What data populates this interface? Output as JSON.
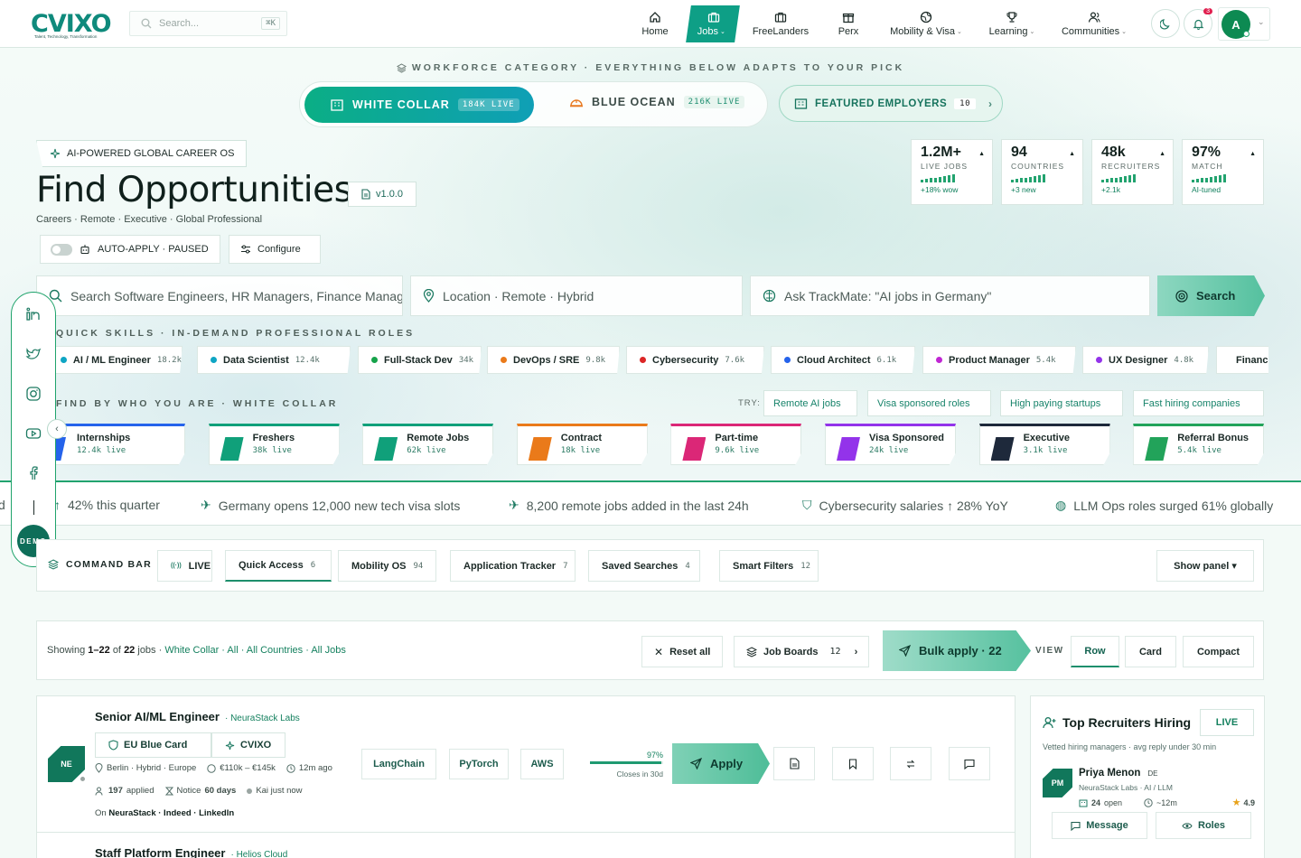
{
  "brand": {
    "name": "CVIXO",
    "tagline": "Talent, Technology, Transformation"
  },
  "top_search": {
    "placeholder": "Search...",
    "shortcut": "⌘K"
  },
  "nav": [
    {
      "label": "Home",
      "icon": "home-icon"
    },
    {
      "label": "Jobs",
      "icon": "briefcase-icon",
      "active": true,
      "dropdown": true
    },
    {
      "label": "FreeLanders",
      "icon": "briefcase-icon"
    },
    {
      "label": "Perx",
      "icon": "gift-icon"
    },
    {
      "label": "Mobility & Visa",
      "icon": "globe-icon",
      "dropdown": true
    },
    {
      "label": "Learning",
      "icon": "trophy-icon",
      "dropdown": true
    },
    {
      "label": "Communities",
      "icon": "users-icon",
      "dropdown": true
    }
  ],
  "user": {
    "avatar_letter": "A",
    "notifications": "3"
  },
  "workforce": {
    "label": "WORKFORCE CATEGORY · EVERYTHING BELOW ADAPTS TO YOUR PICK",
    "white": {
      "label": "WHITE COLLAR",
      "count": "184K LIVE"
    },
    "blue": {
      "label": "BLUE OCEAN",
      "count": "216K LIVE"
    },
    "featured": {
      "label": "FEATURED EMPLOYERS",
      "count": "10"
    }
  },
  "hero": {
    "badge": "AI-POWERED GLOBAL CAREER OS",
    "title": "Find Opportunities",
    "version": "v1.0.0",
    "subtitle": "Careers · Remote · Executive · Global Professional",
    "autoapply": "AUTO-APPLY · PAUSED",
    "configure": "Configure"
  },
  "stats": [
    {
      "value": "1.2M+",
      "label": "LIVE JOBS",
      "delta": "+18% wow"
    },
    {
      "value": "94",
      "label": "COUNTRIES",
      "delta": "+3 new"
    },
    {
      "value": "48k",
      "label": "RECRUITERS",
      "delta": "+2.1k"
    },
    {
      "value": "97%",
      "label": "MATCH",
      "delta": "AI-tuned"
    }
  ],
  "search": {
    "query_placeholder": "Search Software Engineers, HR Managers, Finance Managers",
    "location_placeholder": "Location · Remote · Hybrid",
    "ask_placeholder": "Ask TrackMate: \"AI jobs in Germany\"",
    "button": "Search"
  },
  "skills_label": "QUICK SKILLS · IN-DEMAND PROFESSIONAL ROLES",
  "skills": [
    {
      "name": "AI / ML Engineer",
      "count": "18.2k",
      "color": "#0ea5c4"
    },
    {
      "name": "Data Scientist",
      "count": "12.4k",
      "color": "#0ea5c4"
    },
    {
      "name": "Full-Stack Dev",
      "count": "34k",
      "color": "#16a34a"
    },
    {
      "name": "DevOps / SRE",
      "count": "9.8k",
      "color": "#ea7a1a"
    },
    {
      "name": "Cybersecurity",
      "count": "7.6k",
      "color": "#dc2626"
    },
    {
      "name": "Cloud Architect",
      "count": "6.1k",
      "color": "#2563eb"
    },
    {
      "name": "Product Manager",
      "count": "5.4k",
      "color": "#c026d3"
    },
    {
      "name": "UX Designer",
      "count": "4.8k",
      "color": "#9333ea"
    },
    {
      "name": "Finance Manager",
      "count": "",
      "color": "#0d9466"
    }
  ],
  "who_label": "FIND BY WHO YOU ARE · WHITE COLLAR",
  "try_label": "TRY:",
  "try_chips": [
    "Remote AI jobs",
    "Visa sponsored roles",
    "High paying startups",
    "Fast hiring companies"
  ],
  "categories": [
    {
      "name": "Internships",
      "count": "12.4k live",
      "color": "#2563eb"
    },
    {
      "name": "Freshers",
      "count": "38k live",
      "color": "#10a07a"
    },
    {
      "name": "Remote Jobs",
      "count": "62k live",
      "color": "#10a07a"
    },
    {
      "name": "Contract",
      "count": "18k live",
      "color": "#ea7a1a"
    },
    {
      "name": "Part-time",
      "count": "9.6k live",
      "color": "#db2777"
    },
    {
      "name": "Visa Sponsored",
      "count": "24k live",
      "color": "#9333ea"
    },
    {
      "name": "Executive",
      "count": "3.1k live",
      "color": "#1e293b"
    },
    {
      "name": "Referral Bonus",
      "count": "5.4k live",
      "color": "#22a35a"
    }
  ],
  "ticker": [
    "42% this quarter",
    "Germany opens 12,000 new tech visa slots",
    "8,200 remote jobs added in the last 24h",
    "Cybersecurity salaries ↑ 28% YoY",
    "LLM Ops roles surged 61% globally"
  ],
  "rail": {
    "demo": "DEMO"
  },
  "command": {
    "label": "COMMAND BAR",
    "tabs": [
      {
        "label": "LIVE",
        "count": ""
      },
      {
        "label": "Quick Access",
        "count": "6"
      },
      {
        "label": "Mobility OS",
        "count": "94"
      },
      {
        "label": "Application Tracker",
        "count": "7"
      },
      {
        "label": "Saved Searches",
        "count": "4"
      },
      {
        "label": "Smart Filters",
        "count": "12"
      }
    ],
    "panel": "Show panel ▾"
  },
  "results": {
    "prefix": "Showing",
    "range": "1–22",
    "of": "of",
    "total": "22",
    "suffix": "jobs ·",
    "filters": "White Collar · All · All Countries · All Jobs",
    "reset": "Reset all",
    "boards": "Job Boards",
    "boards_count": "12",
    "bulk": "Bulk apply · 22",
    "view_label": "VIEW",
    "views": [
      "Row",
      "Card",
      "Compact"
    ]
  },
  "jobs": [
    {
      "title": "Senior AI/ML Engineer",
      "company": "· NeuraStack Labs",
      "logo": "NE",
      "tags": [
        "EU Blue Card",
        "CVIXO"
      ],
      "location": "Berlin · Hybrid · Europe",
      "salary": "€110k – €145k",
      "posted": "12m ago",
      "applied_count": "197",
      "applied_word": "applied",
      "notice_label": "Notice",
      "notice": "60 days",
      "status": "Kai just now",
      "on_label": "On",
      "sources": "NeuraStack · Indeed · LinkedIn",
      "tech": [
        "LangChain",
        "PyTorch",
        "AWS"
      ],
      "match": "97%",
      "match_value": 0.97,
      "closes": "Closes in 30d",
      "apply": "Apply"
    },
    {
      "title": "Staff Platform Engineer",
      "company": "· Helios Cloud"
    }
  ],
  "side": {
    "title": "Top Recruiters Hiring",
    "live": "LIVE",
    "desc": "Vetted hiring managers · avg reply under 30 min",
    "recruiter": {
      "logo": "PM",
      "name": "Priya Menon",
      "country": "DE",
      "org": "NeuraStack Labs · AI / LLM",
      "open_count": "24",
      "open_word": "open",
      "reply": "~12m",
      "rating": "4.9"
    },
    "message": "Message",
    "roles": "Roles"
  }
}
